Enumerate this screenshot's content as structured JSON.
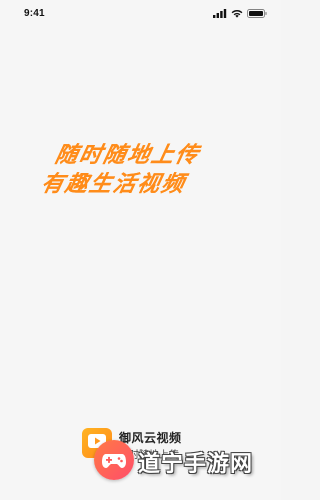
{
  "status_bar": {
    "time": "9:41",
    "icons": [
      "signal-icon",
      "wifi-icon",
      "battery-icon"
    ]
  },
  "splash": {
    "slogan_line1": "随时随地上传",
    "slogan_line2": "有趣生活视频",
    "slogan_color": "#ff8c1a"
  },
  "app": {
    "name": "御风云视频",
    "subtitle": "随时随地上传",
    "logo_icon": "play-icon",
    "logo_color": "#ff9a1f"
  },
  "watermark": {
    "text": "道宁手游网",
    "badge_icon": "controller-icon"
  }
}
